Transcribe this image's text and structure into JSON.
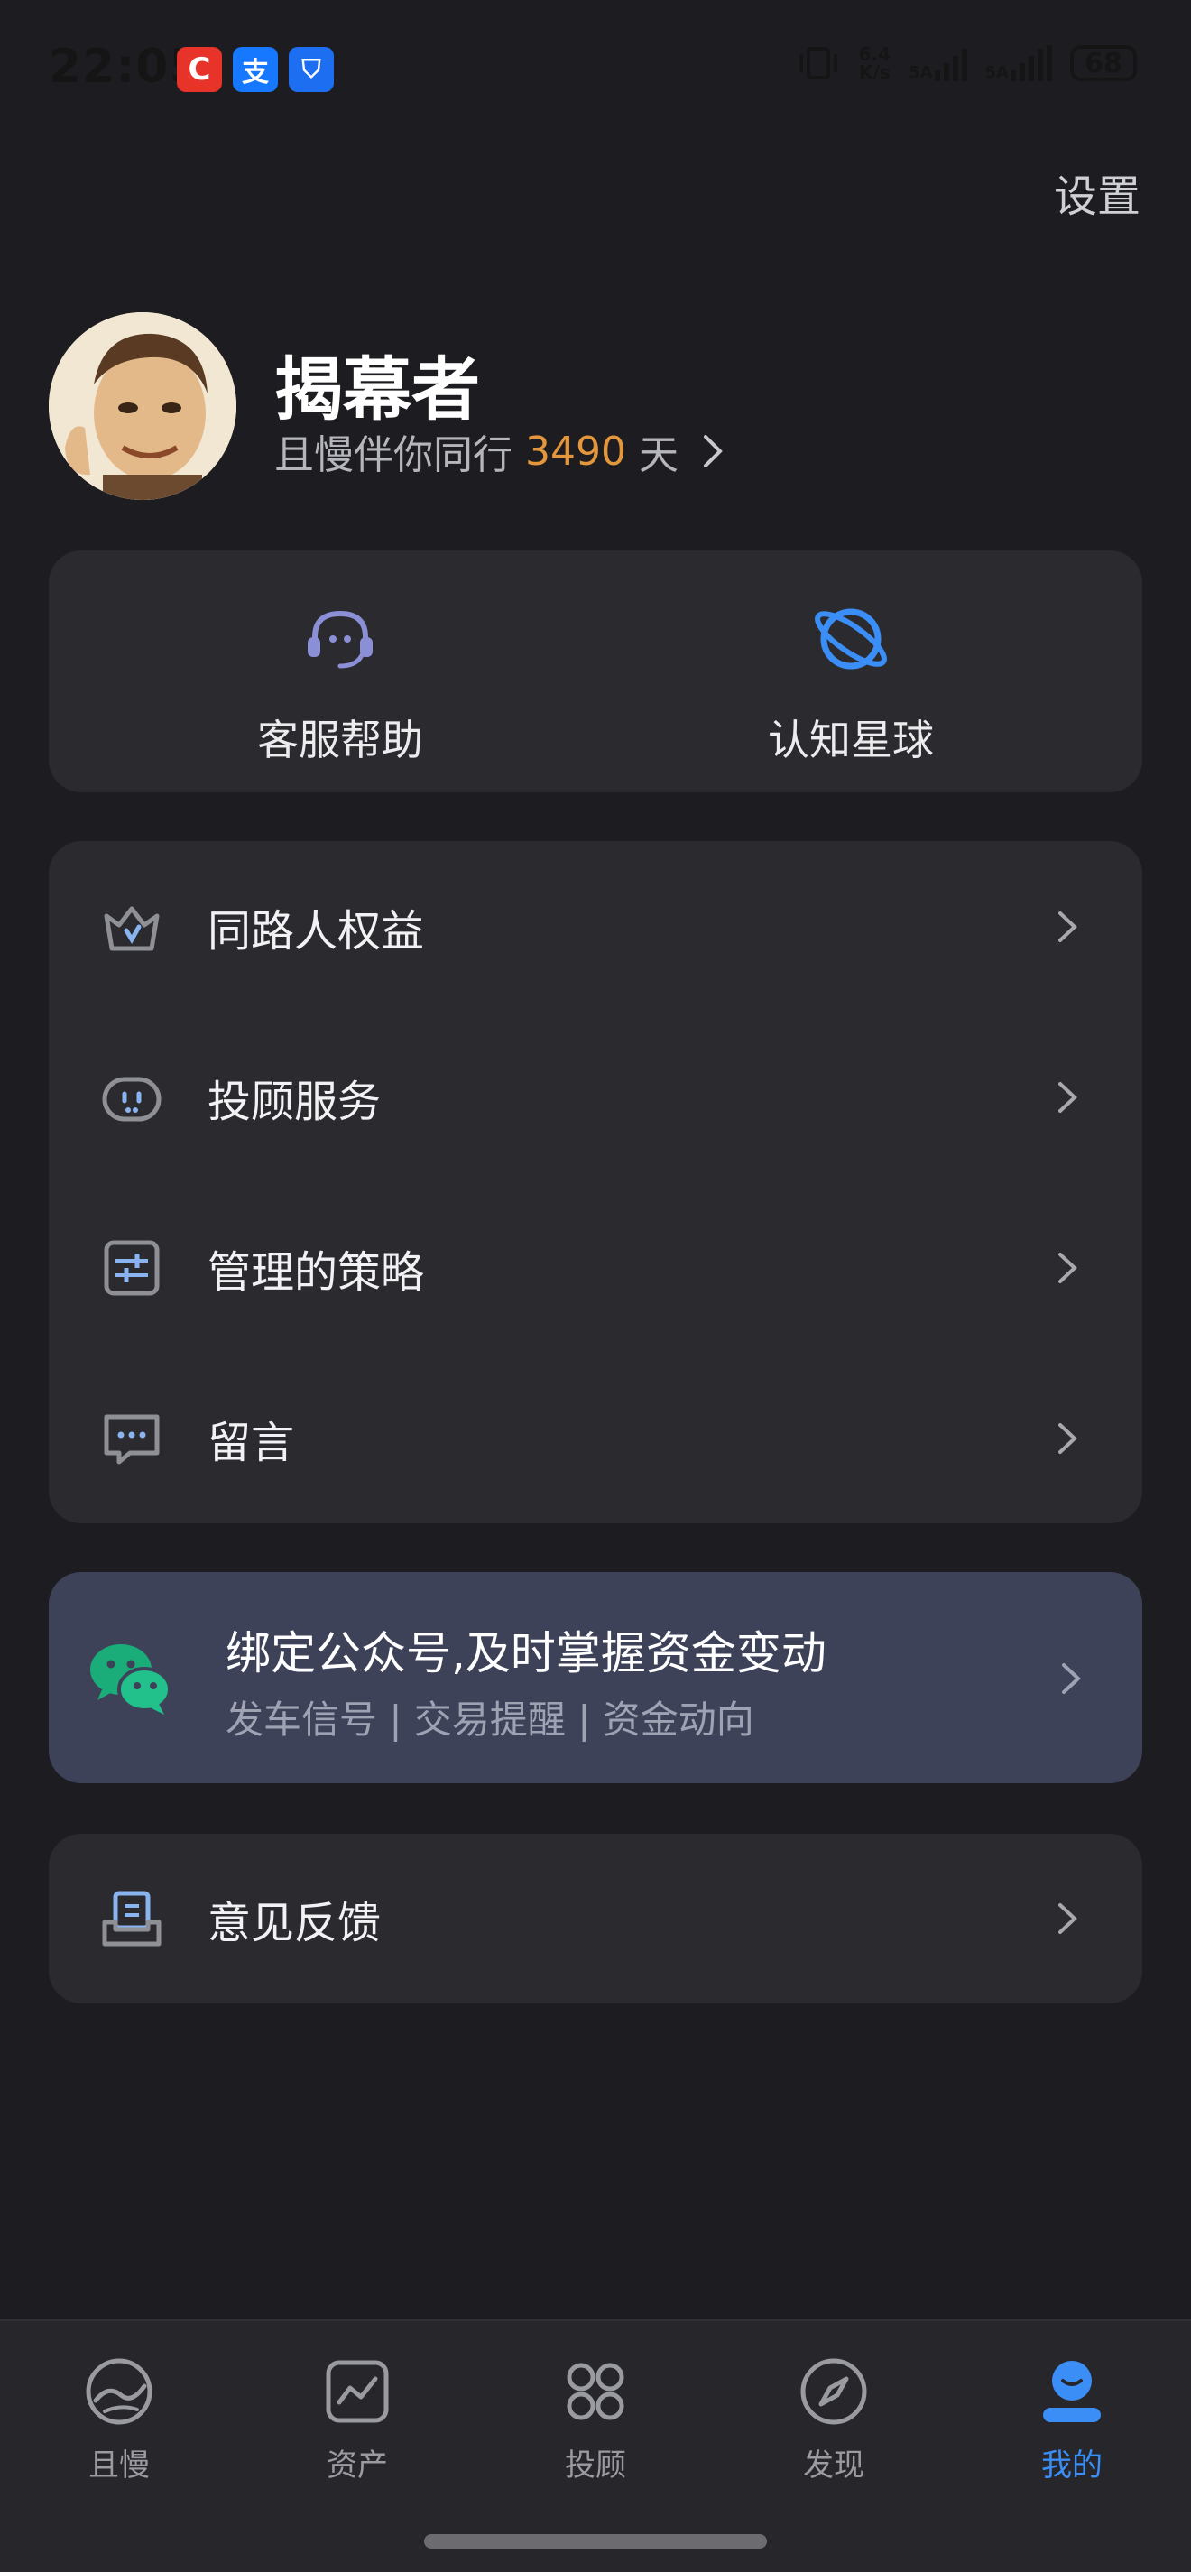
{
  "status_bar": {
    "time": "22:05",
    "apps": [
      {
        "name": "c-app-icon",
        "glyph": "C",
        "color": "#e8332a"
      },
      {
        "name": "alipay-icon",
        "glyph": "支",
        "color": "#1677ff"
      },
      {
        "name": "shield-app-icon",
        "glyph": "⛉",
        "color": "#1e6ef2"
      }
    ],
    "net_speed": "6.4\nK/s",
    "signal_1_label": "5A",
    "signal_2_label": "5A",
    "battery": "68"
  },
  "header": {
    "settings_label": "设置"
  },
  "profile": {
    "name": "揭幕者",
    "subtitle_prefix": "且慢伴你同行",
    "days": "3490",
    "subtitle_suffix": "天"
  },
  "quick_actions": [
    {
      "label": "客服帮助",
      "icon": "headset-icon"
    },
    {
      "label": "认知星球",
      "icon": "planet-icon"
    }
  ],
  "menu": [
    {
      "label": "同路人权益",
      "icon": "crown-icon"
    },
    {
      "label": "投顾服务",
      "icon": "advisor-face-icon"
    },
    {
      "label": "管理的策略",
      "icon": "sliders-icon"
    },
    {
      "label": "留言",
      "icon": "message-icon"
    }
  ],
  "wechat_banner": {
    "title": "绑定公众号,及时掌握资金变动",
    "subtitle": "发车信号 | 交易提醒 | 资金动向"
  },
  "feedback": {
    "label": "意见反馈"
  },
  "tabbar": [
    {
      "label": "且慢",
      "icon": "qieman-logo-icon",
      "active": false
    },
    {
      "label": "资产",
      "icon": "chart-icon",
      "active": false
    },
    {
      "label": "投顾",
      "icon": "grid-icon",
      "active": false
    },
    {
      "label": "发现",
      "icon": "compass-icon",
      "active": false
    },
    {
      "label": "我的",
      "icon": "profile-icon",
      "active": true
    }
  ],
  "colors": {
    "background": "#1d1d21",
    "card": "#2a2a2f",
    "accent_orange": "#e3963b",
    "accent_blue": "#3a8ef5",
    "wechat_banner": "#3d4259",
    "wechat_green": "#1aad7a"
  }
}
